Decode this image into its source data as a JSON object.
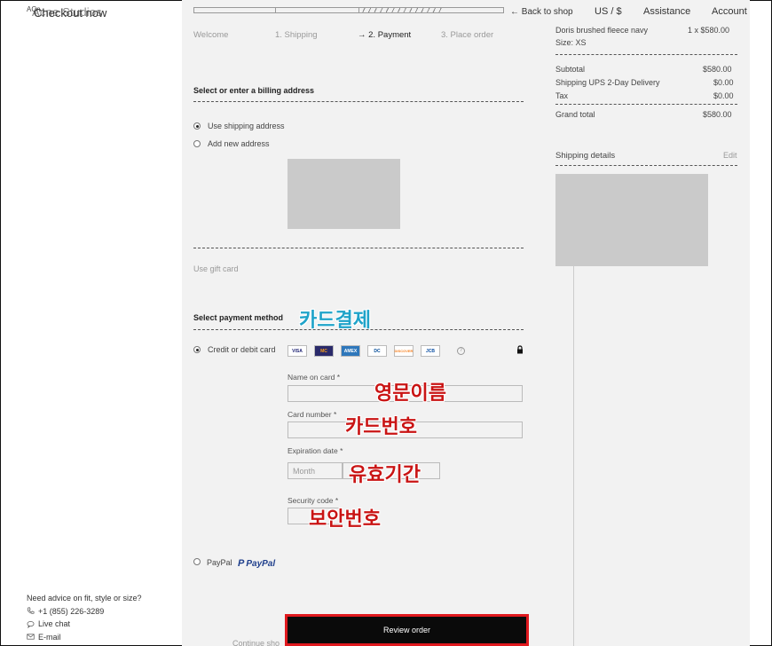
{
  "brand": {
    "small": "ACn",
    "main": "Acne Studios",
    "overlay": "Checkout now"
  },
  "progress": {
    "fraction": 0.54
  },
  "steps": [
    {
      "label": "Welcome"
    },
    {
      "label": "1. Shipping"
    },
    {
      "label": "→ 2. Payment"
    },
    {
      "label": "3. Place order"
    }
  ],
  "nav": {
    "back": "← Back to shop",
    "locale": "US / $",
    "assistance": "Assistance",
    "account": "Account"
  },
  "billing": {
    "title": "Select or enter a billing address",
    "use_shipping": "Use shipping address",
    "add_new": "Add new address"
  },
  "gift_card": "Use gift card",
  "payment": {
    "title": "Select payment method",
    "credit_label": "Credit or debit card",
    "cards": [
      "VISA",
      "MC",
      "AMEX",
      "DC",
      "DISCOVER",
      "JCB"
    ],
    "help": "?",
    "name_label": "Name on card *",
    "number_label": "Card number *",
    "expiry_label": "Expiration date *",
    "expiry_month_placeholder": "Month",
    "security_label": "Security code *",
    "paypal_label": "PayPal",
    "paypal_logo": "PayPal"
  },
  "annotations": {
    "card_payment": "카드결제",
    "english_name": "영문이름",
    "card_number": "카드번호",
    "expiry": "유효기간",
    "security": "보안번호"
  },
  "review_button": "Review order",
  "continue_text": "Continue sho",
  "order": {
    "item_name": "Doris brushed fleece navy",
    "item_size": "Size: XS",
    "item_qty_price": "1 x $580.00",
    "subtotal_label": "Subtotal",
    "subtotal_value": "$580.00",
    "shipping_label": "Shipping UPS 2-Day Delivery",
    "shipping_value": "$0.00",
    "tax_label": "Tax",
    "tax_value": "$0.00",
    "total_label": "Grand total",
    "total_value": "$580.00",
    "shipping_details_label": "Shipping details",
    "edit_label": "Edit"
  },
  "help": {
    "title": "Need advice on fit, style or size?",
    "phone": "+1 (855) 226-3289",
    "chat": "Live chat",
    "email": "E-mail"
  }
}
